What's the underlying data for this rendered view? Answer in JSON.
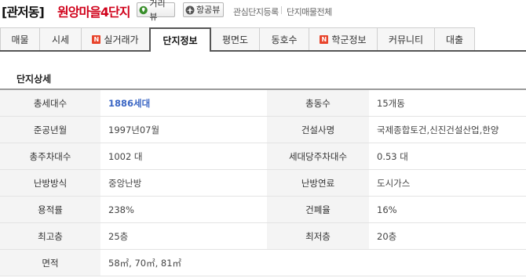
{
  "header": {
    "region": "[관저동]",
    "apartment_name": "원앙마을4단지",
    "street_view_label": "거리뷰",
    "aerial_view_label": "항공뷰",
    "favorite_label": "관심단지등록",
    "all_listings_label": "단지매물전체"
  },
  "tabs": [
    {
      "label": "매물",
      "badge": ""
    },
    {
      "label": "시세",
      "badge": ""
    },
    {
      "label": "실거래가",
      "badge": "N"
    },
    {
      "label": "단지정보",
      "badge": ""
    },
    {
      "label": "평면도",
      "badge": ""
    },
    {
      "label": "동호수",
      "badge": ""
    },
    {
      "label": "학군정보",
      "badge": "N"
    },
    {
      "label": "커뮤니티",
      "badge": ""
    },
    {
      "label": "대출",
      "badge": ""
    }
  ],
  "active_tab": "단지정보",
  "section_title": "단지상세",
  "details": [
    {
      "label1": "총세대수",
      "value1": "1886세대",
      "label2": "총동수",
      "value2": "15개동"
    },
    {
      "label1": "준공년월",
      "value1": "1997년07월",
      "label2": "건설사명",
      "value2": "국제종합토건,신진건설산업,한양"
    },
    {
      "label1": "총주차대수",
      "value1": "1002 대",
      "label2": "세대당주차대수",
      "value2": "0.53 대"
    },
    {
      "label1": "난방방식",
      "value1": "중앙난방",
      "label2": "난방연료",
      "value2": "도시가스"
    },
    {
      "label1": "용적률",
      "value1": "238%",
      "label2": "건폐율",
      "value2": "16%"
    },
    {
      "label1": "최고층",
      "value1": "25층",
      "label2": "최저층",
      "value2": "20층"
    },
    {
      "label1": "면적",
      "value1": "58㎡, 70㎡, 81㎡",
      "label2": "",
      "value2": ""
    }
  ],
  "colors": {
    "apartment_name": "#d0021b",
    "highlight_value": "#3b66c4",
    "new_badge": "#e8452c"
  }
}
